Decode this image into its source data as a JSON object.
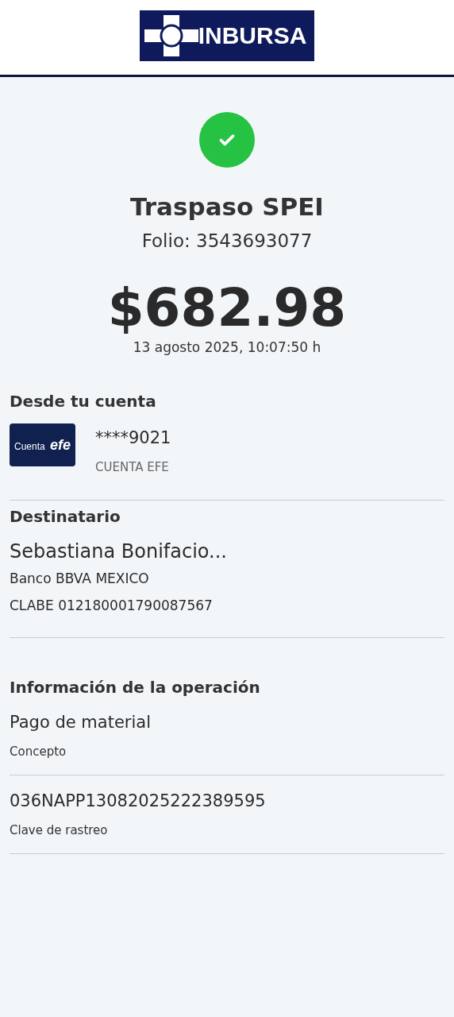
{
  "header": {
    "logo_text": "INBURSA"
  },
  "status": {
    "success": true
  },
  "title": "Traspaso SPEI",
  "folio": "Folio: 3543693077",
  "amount": "$682.98",
  "datetime": "13 agosto 2025, 10:07:50 h",
  "origin": {
    "heading": "Desde tu cuenta",
    "card_label": "Cuenta **efe**",
    "account": "****9021",
    "account_type": "CUENTA EFE"
  },
  "recipient": {
    "heading": "Destinatario",
    "name": "Sebastiana Bonifacio...",
    "bank": "Banco BBVA MEXICO",
    "clabe": "CLABE 012180001790087567"
  },
  "operation": {
    "heading": "Información de la operación",
    "fields": [
      {
        "value": "Pago de material",
        "label": "Concepto"
      },
      {
        "value": "036NAPP13082025222389595",
        "label": "Clave de rastreo"
      }
    ]
  }
}
